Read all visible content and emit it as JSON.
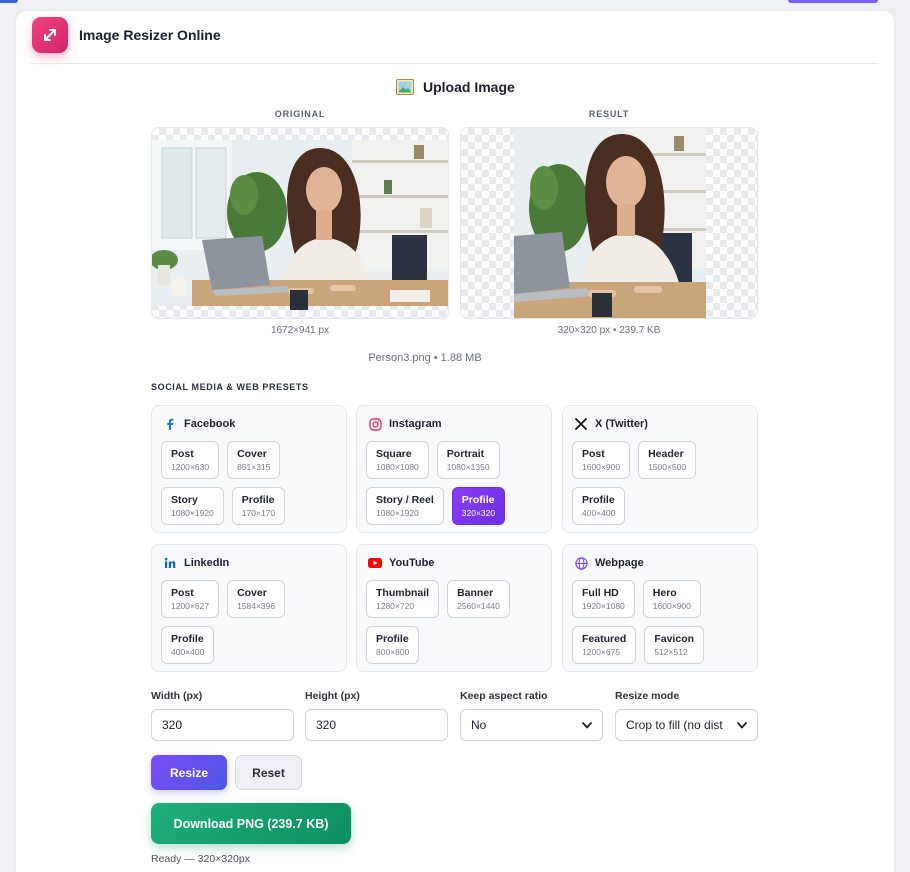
{
  "app": {
    "title": "Image Resizer Online",
    "logo_icon": "resize-arrows-icon"
  },
  "upload": {
    "label": "Upload Image",
    "icon": "picture-icon"
  },
  "original": {
    "heading": "ORIGINAL",
    "caption": "1672×941 px"
  },
  "result": {
    "heading": "RESULT",
    "caption": "320×320 px • 239.7 KB"
  },
  "file_info": "Person3.png • 1.88 MB",
  "presets": {
    "title": "SOCIAL MEDIA & WEB PRESETS",
    "groups": [
      {
        "name": "Facebook",
        "icon": "facebook-icon",
        "items": [
          {
            "name": "Post",
            "dims": "1200×630"
          },
          {
            "name": "Cover",
            "dims": "851×315"
          },
          {
            "name": "Story",
            "dims": "1080×1920"
          },
          {
            "name": "Profile",
            "dims": "170×170"
          }
        ]
      },
      {
        "name": "Instagram",
        "icon": "instagram-icon",
        "items": [
          {
            "name": "Square",
            "dims": "1080×1080"
          },
          {
            "name": "Portrait",
            "dims": "1080×1350"
          },
          {
            "name": "Story / Reel",
            "dims": "1080×1920"
          },
          {
            "name": "Profile",
            "dims": "320×320",
            "active": true
          }
        ]
      },
      {
        "name": "X (Twitter)",
        "icon": "x-icon",
        "items": [
          {
            "name": "Post",
            "dims": "1600×900"
          },
          {
            "name": "Header",
            "dims": "1500×500"
          },
          {
            "name": "Profile",
            "dims": "400×400"
          }
        ]
      },
      {
        "name": "LinkedIn",
        "icon": "linkedin-icon",
        "items": [
          {
            "name": "Post",
            "dims": "1200×627"
          },
          {
            "name": "Cover",
            "dims": "1584×396"
          },
          {
            "name": "Profile",
            "dims": "400×400"
          }
        ]
      },
      {
        "name": "YouTube",
        "icon": "youtube-icon",
        "items": [
          {
            "name": "Thumbnail",
            "dims": "1280×720"
          },
          {
            "name": "Banner",
            "dims": "2560×1440"
          },
          {
            "name": "Profile",
            "dims": "800×800"
          }
        ]
      },
      {
        "name": "Webpage",
        "icon": "globe-icon",
        "items": [
          {
            "name": "Full HD",
            "dims": "1920×1080"
          },
          {
            "name": "Hero",
            "dims": "1600×900"
          },
          {
            "name": "Featured",
            "dims": "1200×675"
          },
          {
            "name": "Favicon",
            "dims": "512×512"
          }
        ]
      }
    ]
  },
  "controls": {
    "width_label": "Width (px)",
    "width_value": "320",
    "height_label": "Height (px)",
    "height_value": "320",
    "aspect_label": "Keep aspect ratio",
    "aspect_value": "No",
    "mode_label": "Resize mode",
    "mode_value": "Crop to fill (no dist"
  },
  "actions": {
    "resize": "Resize",
    "reset": "Reset",
    "download": "Download PNG (239.7 KB)"
  },
  "status": "Ready — 320×320px",
  "colors": {
    "accent_purple": "#7c4df2",
    "download_green": "#1fae7a",
    "logo_pink": "#e8336f",
    "active_preset": "#7a36ee"
  }
}
